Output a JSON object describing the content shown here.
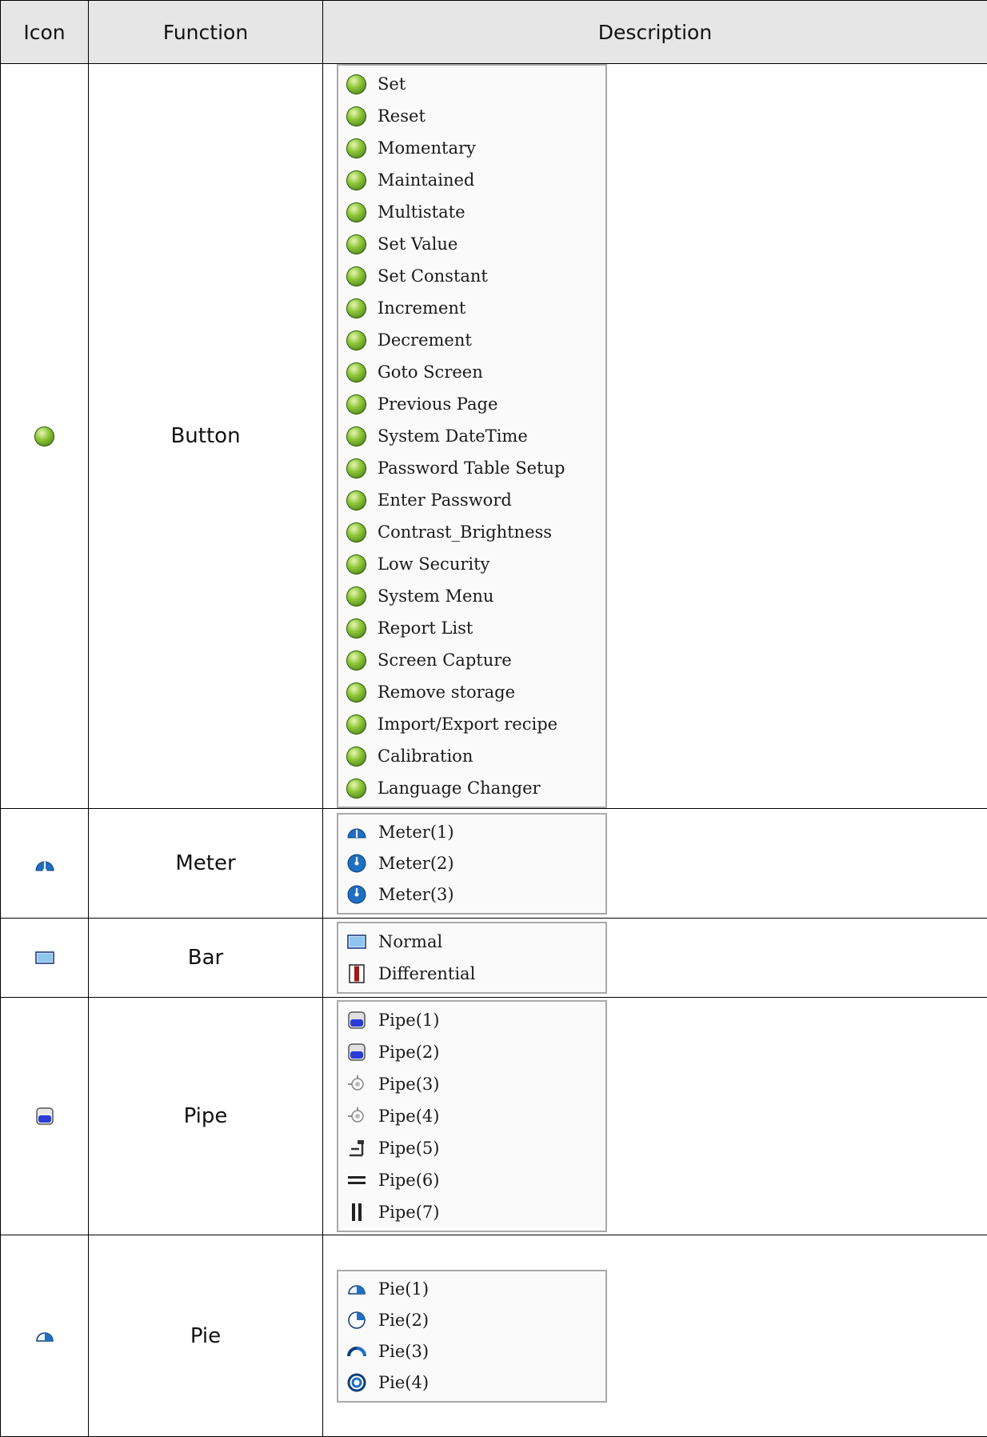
{
  "header": {
    "icon": "Icon",
    "function": "Function",
    "description": "Description"
  },
  "rows": {
    "button": {
      "function": "Button",
      "icon": "green-button-icon",
      "items": [
        "Set",
        "Reset",
        "Momentary",
        "Maintained",
        "Multistate",
        "Set Value",
        "Set Constant",
        "Increment",
        "Decrement",
        "Goto Screen",
        "Previous Page",
        "System DateTime",
        "Password Table Setup",
        "Enter Password",
        "Contrast_Brightness",
        "Low Security",
        "System Menu",
        "Report List",
        "Screen Capture",
        "Remove storage",
        "Import/Export recipe",
        "Calibration",
        "Language Changer"
      ]
    },
    "meter": {
      "function": "Meter",
      "icon": "meter-icon",
      "items": [
        "Meter(1)",
        "Meter(2)",
        "Meter(3)"
      ]
    },
    "bar": {
      "function": "Bar",
      "icon": "bar-icon",
      "items": [
        "Normal",
        "Differential"
      ]
    },
    "pipe": {
      "function": "Pipe",
      "icon": "pipe-icon",
      "items": [
        "Pipe(1)",
        "Pipe(2)",
        "Pipe(3)",
        "Pipe(4)",
        "Pipe(5)",
        "Pipe(6)",
        "Pipe(7)"
      ]
    },
    "pie": {
      "function": "Pie",
      "icon": "pie-icon",
      "items": [
        "Pie(1)",
        "Pie(2)",
        "Pie(3)",
        "Pie(4)"
      ]
    }
  },
  "colors": {
    "header_bg": "#e6e6e6",
    "button_green": "#6aa82a",
    "meter_blue": "#1f6fc2",
    "pipe_blue": "#2a3cd6",
    "bar_red": "#a01818"
  }
}
